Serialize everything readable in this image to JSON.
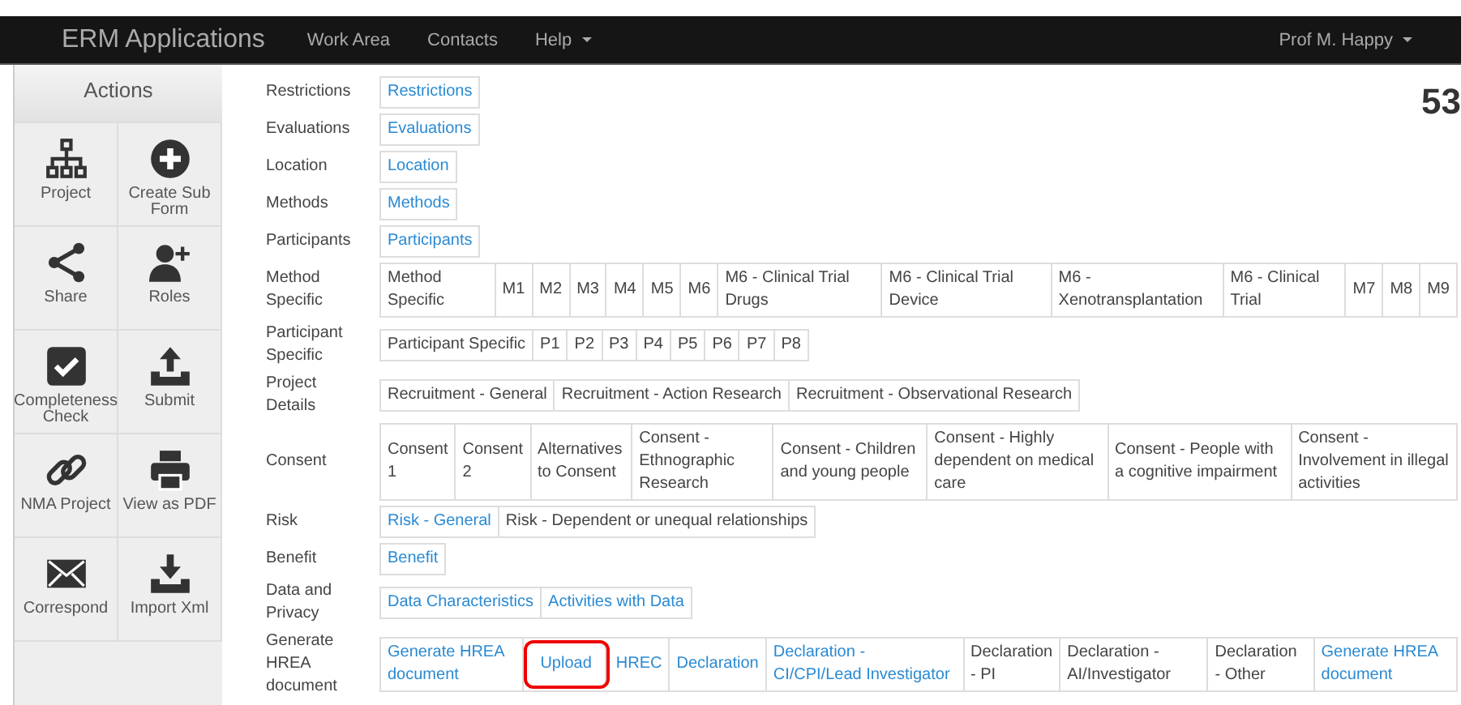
{
  "navbar": {
    "brand": "ERM Applications",
    "items": [
      {
        "label": "Work Area",
        "dropdown": false
      },
      {
        "label": "Contacts",
        "dropdown": false
      },
      {
        "label": "Help",
        "dropdown": true
      }
    ],
    "user": {
      "label": "Prof M. Happy",
      "dropdown": true
    }
  },
  "sidebar": {
    "title": "Actions",
    "items": [
      {
        "label": "Project",
        "kind": "sitemap"
      },
      {
        "label": "Create Sub Form",
        "kind": "plus"
      },
      {
        "label": "Share",
        "kind": "share"
      },
      {
        "label": "Roles",
        "kind": "user-plus"
      },
      {
        "label": "Completeness Check",
        "kind": "check"
      },
      {
        "label": "Submit",
        "kind": "upload"
      },
      {
        "label": "NMA Project",
        "kind": "link"
      },
      {
        "label": "View as PDF",
        "kind": "print"
      },
      {
        "label": "Correspond",
        "kind": "mail"
      },
      {
        "label": "Import Xml",
        "kind": "download"
      }
    ]
  },
  "record_number": "53",
  "sections": [
    {
      "label": "Restrictions",
      "cells": [
        {
          "text": "Restrictions",
          "kind": "link"
        }
      ]
    },
    {
      "label": "Evaluations",
      "cells": [
        {
          "text": "Evaluations",
          "kind": "link"
        }
      ]
    },
    {
      "label": "Location",
      "cells": [
        {
          "text": "Location",
          "kind": "link"
        }
      ]
    },
    {
      "label": "Methods",
      "cells": [
        {
          "text": "Methods",
          "kind": "link"
        }
      ]
    },
    {
      "label": "Participants",
      "cells": [
        {
          "text": "Participants",
          "kind": "link"
        }
      ]
    },
    {
      "label": "Method Specific",
      "cells": [
        {
          "text": "Method Specific",
          "kind": "text"
        },
        {
          "text": "M1",
          "kind": "text"
        },
        {
          "text": "M2",
          "kind": "text"
        },
        {
          "text": "M3",
          "kind": "text"
        },
        {
          "text": "M4",
          "kind": "text"
        },
        {
          "text": "M5",
          "kind": "text"
        },
        {
          "text": "M6",
          "kind": "text"
        },
        {
          "text": "M6 - Clinical Trial Drugs",
          "kind": "text"
        },
        {
          "text": "M6 - Clinical Trial Device",
          "kind": "text"
        },
        {
          "text": "M6 - Xenotransplantation",
          "kind": "text"
        },
        {
          "text": "M6 - Clinical Trial",
          "kind": "text"
        },
        {
          "text": "M7",
          "kind": "text"
        },
        {
          "text": "M8",
          "kind": "text"
        },
        {
          "text": "M9",
          "kind": "text"
        }
      ]
    },
    {
      "label": "Participant Specific",
      "cells": [
        {
          "text": "Participant Specific",
          "kind": "text"
        },
        {
          "text": "P1",
          "kind": "text"
        },
        {
          "text": "P2",
          "kind": "text"
        },
        {
          "text": "P3",
          "kind": "text"
        },
        {
          "text": "P4",
          "kind": "text"
        },
        {
          "text": "P5",
          "kind": "text"
        },
        {
          "text": "P6",
          "kind": "text"
        },
        {
          "text": "P7",
          "kind": "text"
        },
        {
          "text": "P8",
          "kind": "text"
        }
      ]
    },
    {
      "label": "Project Details",
      "cells": [
        {
          "text": "Recruitment - General",
          "kind": "text"
        },
        {
          "text": "Recruitment - Action Research",
          "kind": "text"
        },
        {
          "text": "Recruitment - Observational Research",
          "kind": "text"
        }
      ]
    },
    {
      "label": "Consent",
      "cells": [
        {
          "text": "Consent 1",
          "kind": "text"
        },
        {
          "text": "Consent 2",
          "kind": "text"
        },
        {
          "text": "Alternatives to Consent",
          "kind": "text"
        },
        {
          "text": "Consent - Ethnographic Research",
          "kind": "text"
        },
        {
          "text": "Consent - Children and young people",
          "kind": "text"
        },
        {
          "text": "Consent - Highly dependent on medical care",
          "kind": "text"
        },
        {
          "text": "Consent - People with a cognitive impairment",
          "kind": "text"
        },
        {
          "text": "Consent - Involvement in illegal activities",
          "kind": "text"
        }
      ]
    },
    {
      "label": "Risk",
      "cells": [
        {
          "text": "Risk - General",
          "kind": "link"
        },
        {
          "text": "Risk - Dependent or unequal relationships",
          "kind": "text"
        }
      ]
    },
    {
      "label": "Benefit",
      "cells": [
        {
          "text": "Benefit",
          "kind": "link"
        }
      ]
    },
    {
      "label": "Data and Privacy",
      "cells": [
        {
          "text": "Data Characteristics",
          "kind": "link"
        },
        {
          "text": "Activities with Data",
          "kind": "link"
        }
      ]
    },
    {
      "label": "Generate HREA document",
      "cells": [
        {
          "text": "Generate HREA document",
          "kind": "link"
        },
        {
          "text": "Upload",
          "kind": "link",
          "highlighted": true
        },
        {
          "text": "HREC",
          "kind": "link"
        },
        {
          "text": "Declaration",
          "kind": "link"
        },
        {
          "text": "Declaration - CI/CPI/Lead Investigator",
          "kind": "link"
        },
        {
          "text": "Declaration - PI",
          "kind": "text"
        },
        {
          "text": "Declaration - AI/Investigator",
          "kind": "text"
        },
        {
          "text": "Declaration - Other",
          "kind": "text"
        },
        {
          "text": "Generate HREA document",
          "kind": "link"
        }
      ]
    }
  ]
}
